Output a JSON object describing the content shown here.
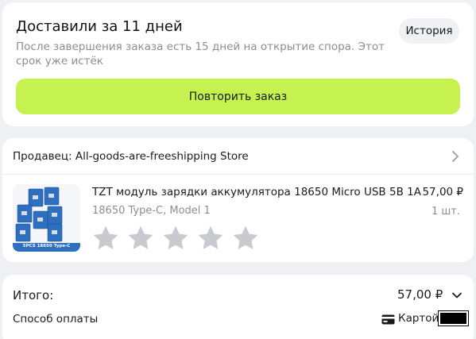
{
  "delivery": {
    "title": "Доставили за 11 дней",
    "description": "После завершения заказа есть 15 дней на открытие спора. Этот срок уже истёк",
    "history_label": "История",
    "repeat_label": "Повторить заказ"
  },
  "order": {
    "seller_label": "Продавец: All-goods-are-freeshipping Store",
    "product": {
      "title": "TZT модуль зарядки аккумулятора 18650 Micro USB 5В 1А",
      "variant": "18650 Type-C, Model 1",
      "price": "57,00 ₽",
      "quantity": "1 шт.",
      "image_caption": "5PCS 18650 Type-C",
      "rating": 0,
      "rating_max": 5
    }
  },
  "summary": {
    "total_label": "Итого:",
    "total_value": "57,00 ₽",
    "payment_label": "Способ оплаты",
    "payment_value": "Картой"
  },
  "colors": {
    "accent": "#c6f24f",
    "background": "#eef0f3",
    "muted_text": "#8a8d94",
    "star_empty": "#c8cacf"
  }
}
